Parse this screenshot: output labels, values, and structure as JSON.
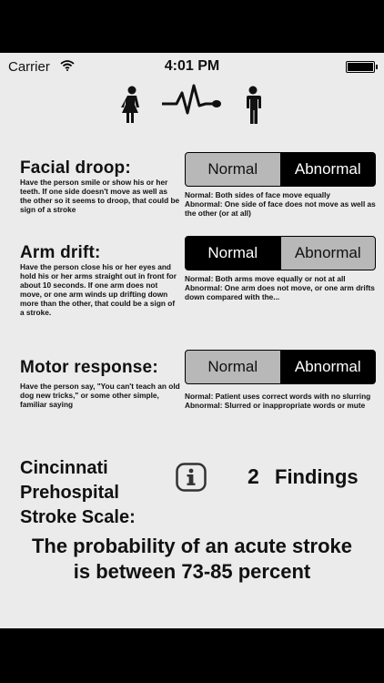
{
  "status_bar": {
    "carrier": "Carrier",
    "time": "4:01 PM"
  },
  "header_icons": [
    "female-figure-icon",
    "heartbeat-line-icon",
    "male-figure-icon"
  ],
  "rows": [
    {
      "title": "Facial droop:",
      "description": "Have the person smile or show his or her teeth. If one side doesn't move as well as the other so it seems to droop, that could be sign of a stroke",
      "options": [
        "Normal",
        "Abnormal"
      ],
      "selected": "Abnormal",
      "note": "Normal: Both sides of face move equally\nAbnormal: One side of face does not move as well as the other (or at all)"
    },
    {
      "title": "Arm drift:",
      "description": "Have the person close his or her eyes and hold his or her arms straight out in front for about 10 seconds. If one arm does not move, or one arm winds up drifting down more than the other, that could be a sign of a stroke.",
      "options": [
        "Normal",
        "Abnormal"
      ],
      "selected": "Normal",
      "note": "Normal: Both arms move equally or not at all\nAbnormal: One arm does not move, or one arm drifts down compared with the..."
    },
    {
      "title": "Motor response:",
      "description": "Have the person say, \"You can't teach an old dog new tricks,\" or some other simple, familiar saying",
      "options": [
        "Normal",
        "Abnormal"
      ],
      "selected": "Abnormal",
      "note": "Normal: Patient uses correct words with no slurring\nAbnormal: Slurred or inappropriate words or mute"
    }
  ],
  "scale": {
    "title_line1": "Cincinnati",
    "title_line2": "Prehospital",
    "title_line3": "Stroke Scale:",
    "findings_count": "2",
    "findings_label": "Findings"
  },
  "probability": {
    "line1": "The probability of an acute stroke",
    "line2": "is between 73-85 percent"
  }
}
